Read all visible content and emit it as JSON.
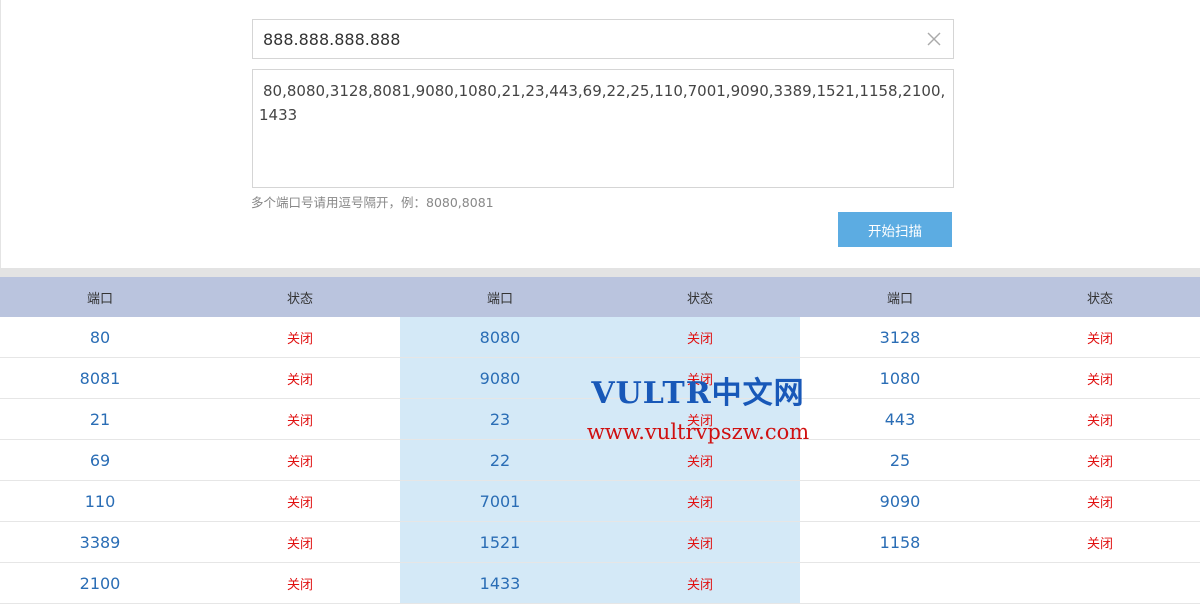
{
  "form": {
    "host_value": "888.888.888.888",
    "ports_value": "80,8080,3128,8081,9080,1080,21,23,443,69,22,25,110,7001,9090,3389,1521,1158,2100,1433",
    "hint": "多个端口号请用逗号隔开，例：8080,8081",
    "scan_label": "开始扫描",
    "clear_icon": "close-icon"
  },
  "table": {
    "headers": [
      "端口",
      "状态",
      "端口",
      "状态",
      "端口",
      "状态"
    ],
    "rows": [
      [
        {
          "port": "80",
          "state": "关闭"
        },
        {
          "port": "8080",
          "state": "关闭"
        },
        {
          "port": "3128",
          "state": "关闭"
        }
      ],
      [
        {
          "port": "8081",
          "state": "关闭"
        },
        {
          "port": "9080",
          "state": "关闭"
        },
        {
          "port": "1080",
          "state": "关闭"
        }
      ],
      [
        {
          "port": "21",
          "state": "关闭"
        },
        {
          "port": "23",
          "state": "关闭"
        },
        {
          "port": "443",
          "state": "关闭"
        }
      ],
      [
        {
          "port": "69",
          "state": "关闭"
        },
        {
          "port": "22",
          "state": "关闭"
        },
        {
          "port": "25",
          "state": "关闭"
        }
      ],
      [
        {
          "port": "110",
          "state": "关闭"
        },
        {
          "port": "7001",
          "state": "关闭"
        },
        {
          "port": "9090",
          "state": "关闭"
        }
      ],
      [
        {
          "port": "3389",
          "state": "关闭"
        },
        {
          "port": "1521",
          "state": "关闭"
        },
        {
          "port": "1158",
          "state": "关闭"
        }
      ],
      [
        {
          "port": "2100",
          "state": "关闭"
        },
        {
          "port": "1433",
          "state": "关闭"
        },
        {
          "port": "",
          "state": ""
        }
      ]
    ]
  },
  "watermark": {
    "title": "VULTR中文网",
    "url": "www.vultrvpszw.com"
  },
  "colors": {
    "port_text": "#2a6db5",
    "closed_text": "#e01010",
    "header_bg": "#bac4de",
    "middle_column_bg": "#d4e9f7",
    "button_bg": "#5cace2"
  }
}
